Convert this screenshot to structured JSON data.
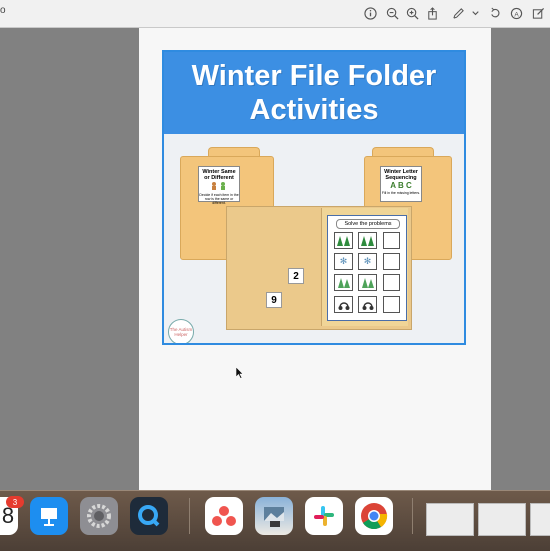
{
  "toolbar": {
    "left_fragment": "o",
    "icons": [
      "info-icon",
      "zoom-out-icon",
      "zoom-in-icon",
      "share-icon",
      "markup-pen-icon",
      "chevron-down-icon",
      "rotate-icon",
      "annotate-circle-icon",
      "edit-box-icon"
    ]
  },
  "cover": {
    "title_line1": "Winter File Folder",
    "title_line2": "Activities",
    "left_folder_label": {
      "title": "Winter Same or Different",
      "caption": "Decide if each item in the row is the same or different."
    },
    "right_folder_label": {
      "title": "Winter Letter Sequencing",
      "letters": "A B C",
      "caption": "Fill in the missing letters."
    },
    "worksheet": {
      "title": "Solve the problems",
      "operator": "+"
    },
    "number_cards": [
      "2",
      "9"
    ],
    "logo_text": "The Autism Helper"
  },
  "dock": {
    "badge_count": "3",
    "calendar_digit": "8",
    "apps": [
      "calendar",
      "keynote",
      "system-settings",
      "quicktime",
      "asana",
      "preview-photo",
      "slack",
      "chrome"
    ]
  },
  "colors": {
    "banner_blue": "#3c8fe3",
    "folder_tan": "#f3c57b",
    "page_bg": "#f7f7f7",
    "viewer_bg": "#808080"
  }
}
